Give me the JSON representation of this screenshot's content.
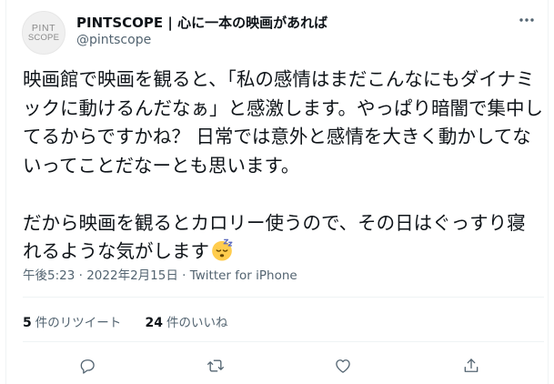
{
  "account": {
    "avatar_line1": "PINT",
    "avatar_line2": "SCOPE",
    "display_name": "PINTSCOPE | 心に一本の映画があれば",
    "handle": "@pintscope"
  },
  "tweet": {
    "text": "映画館で映画を観ると、「私の感情はまだこんなにもダイナミックに動けるんだなぁ」と感激します。やっぱり暗闇で集中してるからですかね？ 日常では意外と感情を大きく動かしてないってことだなーとも思います。\n\nだから映画を観るとカロリー使うので、その日はぐっすり寝れるような気がします",
    "emoji": "sleeping-face",
    "time": "午後5:23",
    "date": "2022年2月15日",
    "source": "Twitter for iPhone",
    "separator": "·"
  },
  "stats": {
    "retweets_count": "5",
    "retweets_label": "件のリツイート",
    "likes_count": "24",
    "likes_label": "件のいいね"
  },
  "actions": {
    "icons": [
      "reply-icon",
      "retweet-icon",
      "like-icon",
      "share-icon"
    ]
  },
  "colors": {
    "text_primary": "#0f1419",
    "text_secondary": "#536471",
    "divider": "#eff3f4",
    "emoji_face": "#ffcc4d",
    "emoji_zzz": "#5c6bc0"
  }
}
